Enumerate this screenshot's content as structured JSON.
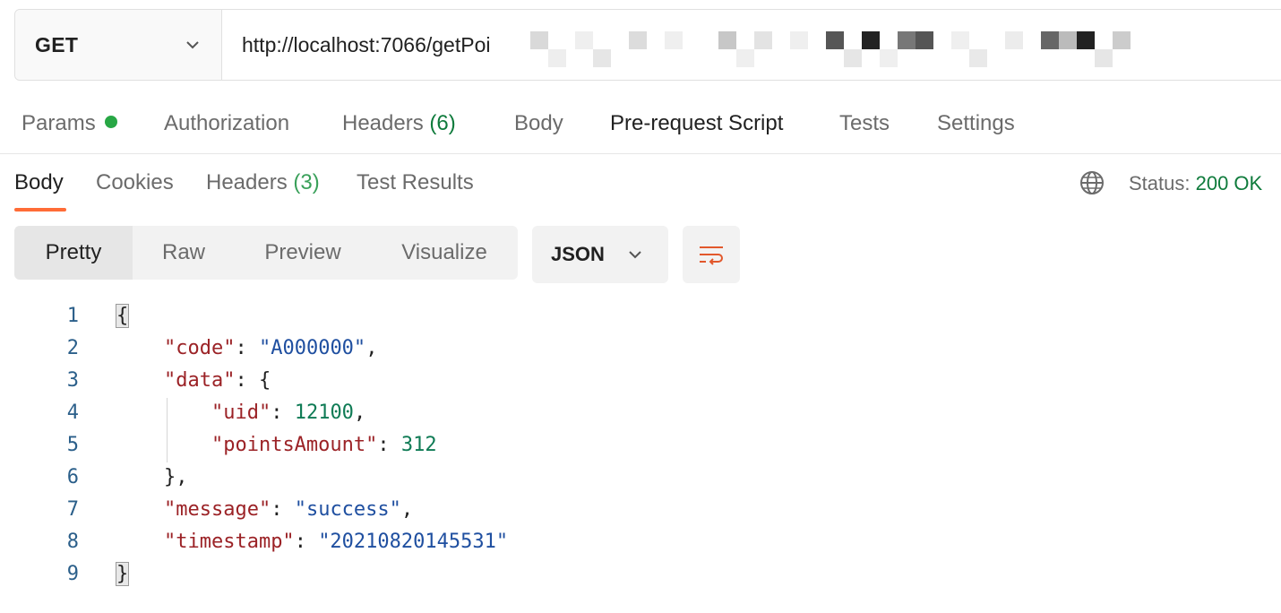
{
  "request": {
    "method": "GET",
    "url": "http://localhost:7066/getPoi"
  },
  "request_tabs": {
    "params": "Params",
    "authorization": "Authorization",
    "headers": "Headers",
    "headers_count": "(6)",
    "body": "Body",
    "pre_request": "Pre-request Script",
    "tests": "Tests",
    "settings": "Settings"
  },
  "response_tabs": {
    "body": "Body",
    "cookies": "Cookies",
    "headers": "Headers",
    "headers_count": "(3)",
    "test_results": "Test Results"
  },
  "status": {
    "label": "Status:",
    "value": "200 OK"
  },
  "view_modes": {
    "pretty": "Pretty",
    "raw": "Raw",
    "preview": "Preview",
    "visualize": "Visualize"
  },
  "format": {
    "selected": "JSON"
  },
  "code_lines": {
    "n1": "1",
    "n2": "2",
    "n3": "3",
    "n4": "4",
    "n5": "5",
    "n6": "6",
    "n7": "7",
    "n8": "8",
    "n9": "9",
    "l1_open": "{",
    "l2_key": "\"code\"",
    "l2_val": "\"A000000\"",
    "l3_key": "\"data\"",
    "l3_open": "{",
    "l4_key": "\"uid\"",
    "l4_val": "12100",
    "l5_key": "\"pointsAmount\"",
    "l5_val": "312",
    "l6_close": "}",
    "l7_key": "\"message\"",
    "l7_val": "\"success\"",
    "l8_key": "\"timestamp\"",
    "l8_val": "\"20210820145531\"",
    "l9_close": "}"
  },
  "icons": {
    "method_dropdown": "chevron-down-icon",
    "format_dropdown": "chevron-down-icon",
    "wrap": "wrap-lines-icon",
    "network": "globe-icon"
  },
  "colors": {
    "accent": "#ff6c37",
    "status_ok": "#0f7b3c",
    "json_key": "#9b2226",
    "json_string": "#1f4fa0",
    "json_number": "#0f7b55"
  }
}
